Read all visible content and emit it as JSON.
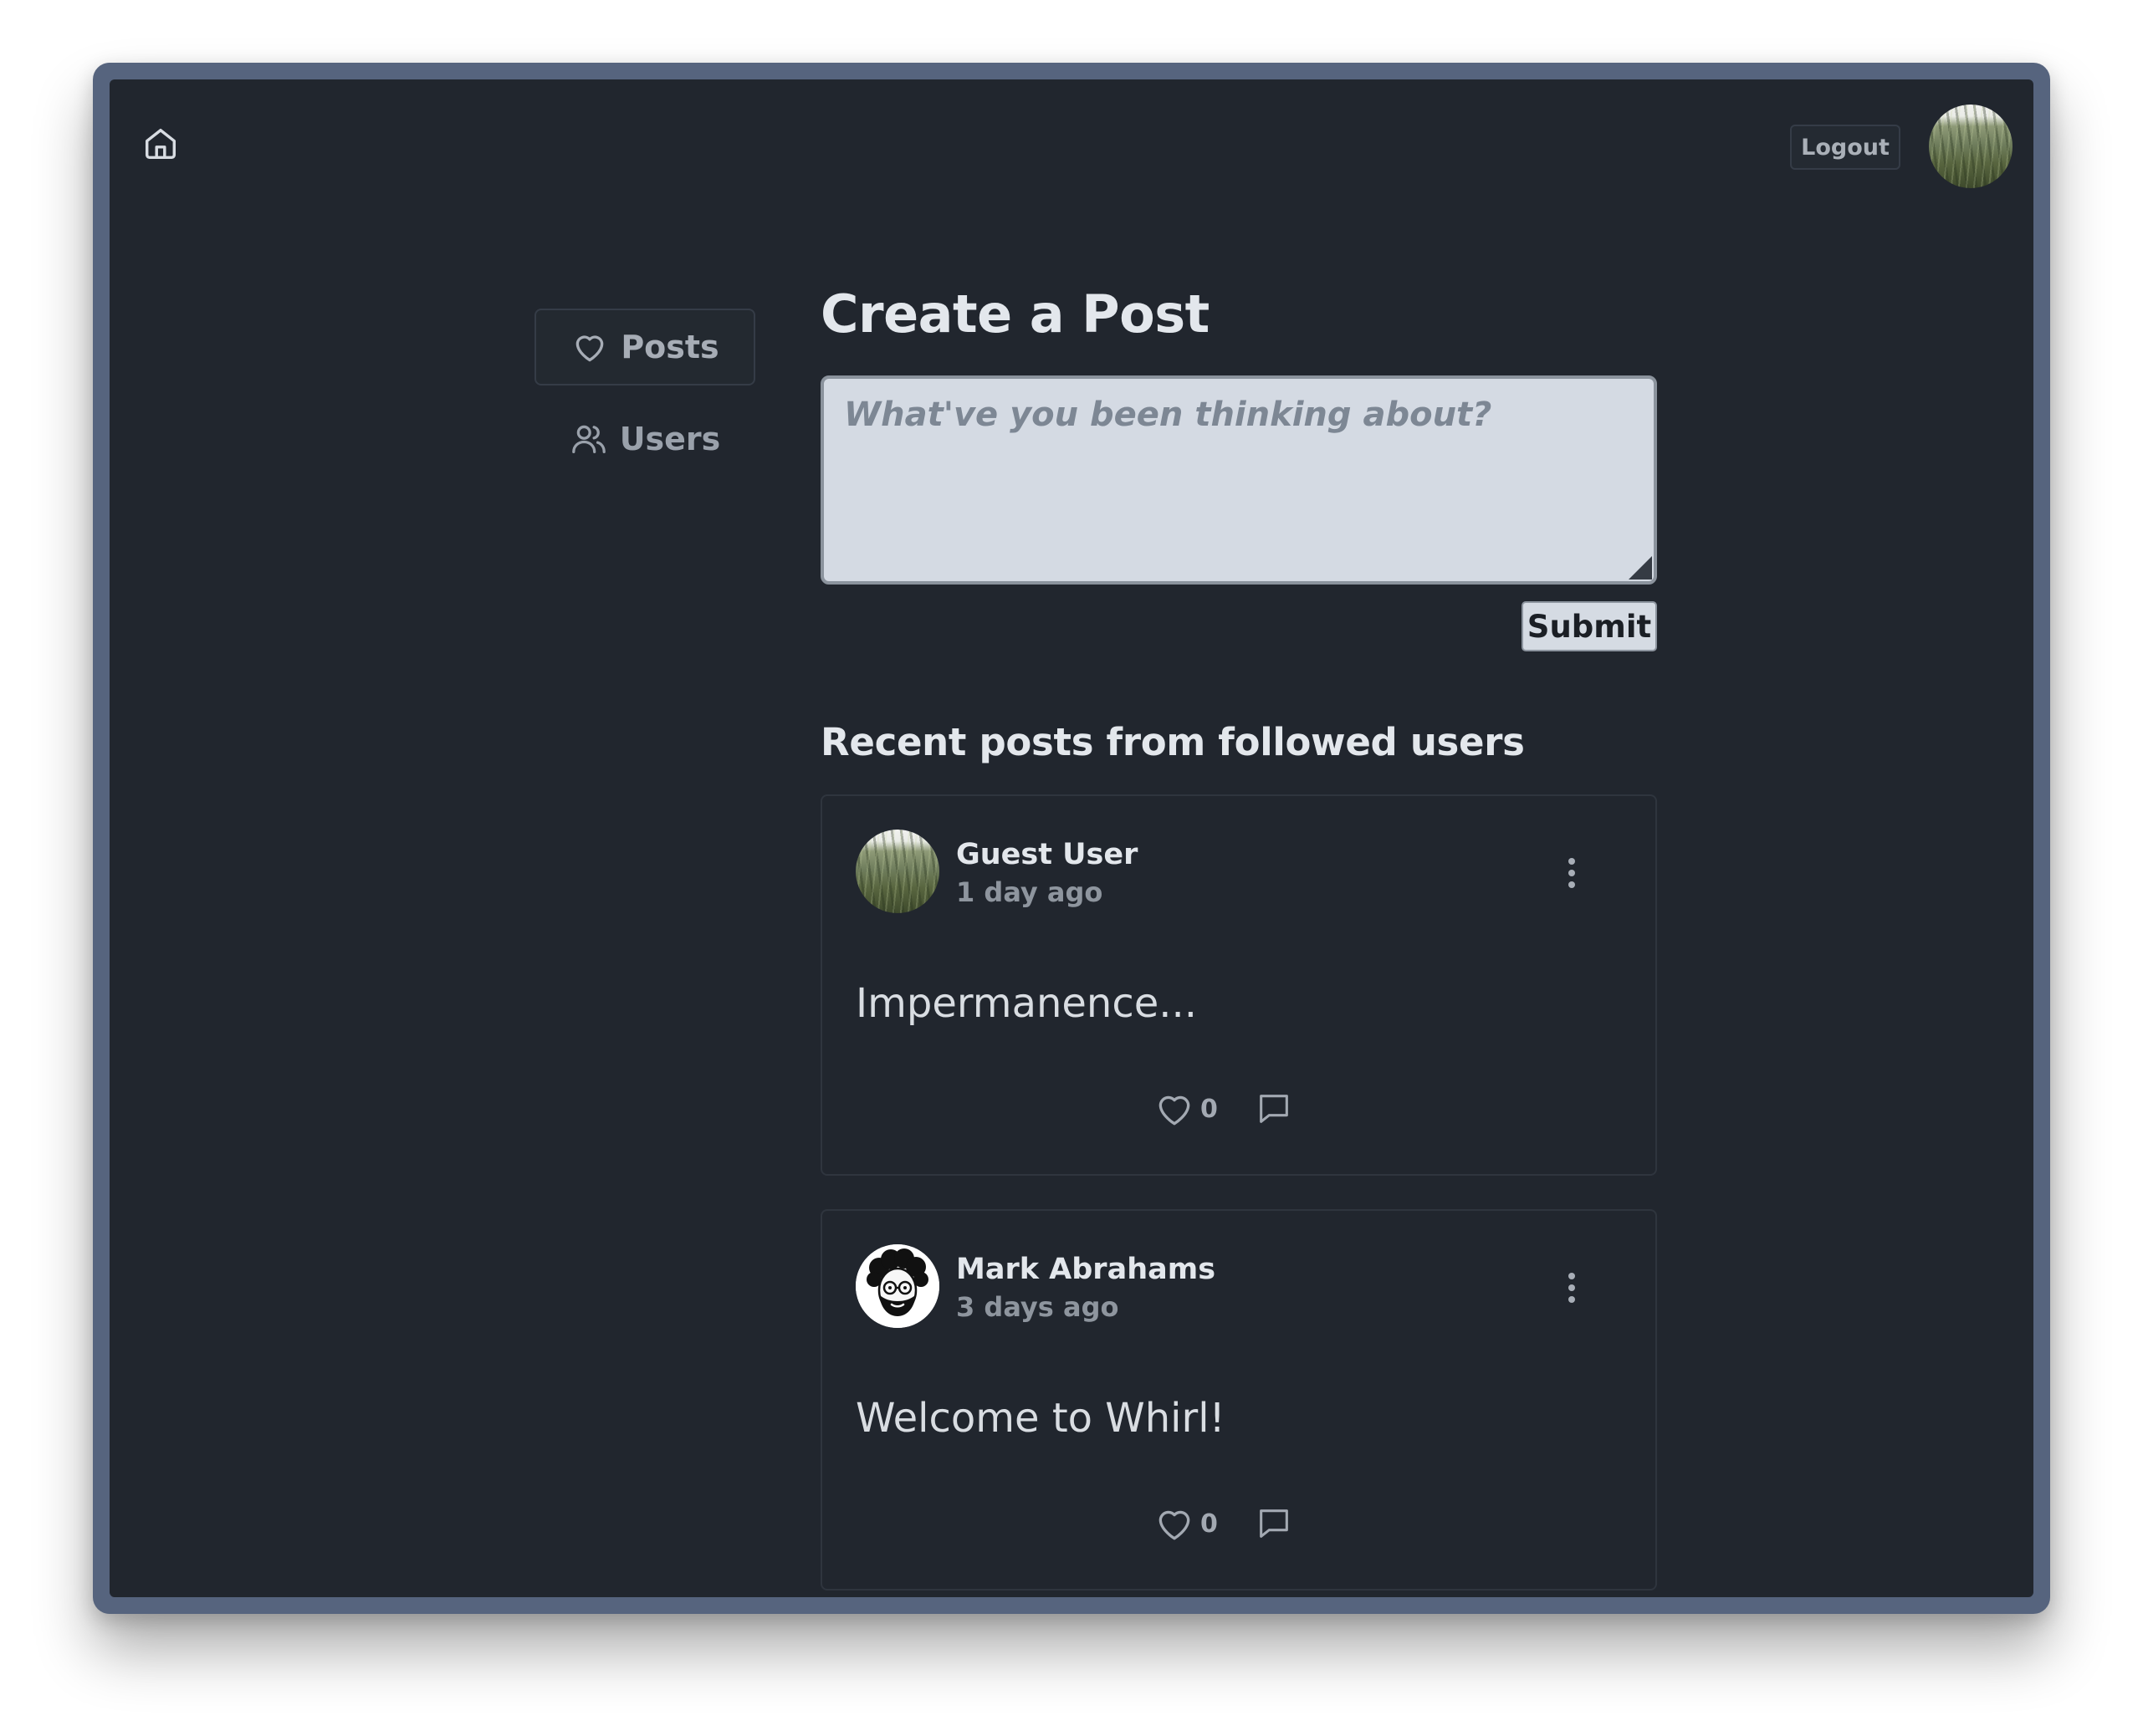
{
  "header": {
    "home_icon": "home-icon",
    "logout_label": "Logout",
    "avatar": "user-avatar-wheat-field"
  },
  "sidebar": {
    "items": [
      {
        "label": "Posts",
        "icon": "heart-icon",
        "active": true
      },
      {
        "label": "Users",
        "icon": "users-icon",
        "active": false
      }
    ]
  },
  "composer": {
    "title": "Create a Post",
    "placeholder": "What've you been thinking about?",
    "submit_label": "Submit"
  },
  "feed": {
    "title": "Recent posts from followed users",
    "posts": [
      {
        "author": "Guest User",
        "time": "1 day ago",
        "body": "Impermanence...",
        "likes": "0",
        "avatar": "wheat-field-photo"
      },
      {
        "author": "Mark Abrahams",
        "time": "3 days ago",
        "body": "Welcome to Whirl!",
        "likes": "0",
        "avatar": "cartoon-man-glasses-beard"
      }
    ]
  },
  "colors": {
    "page_background": "#21262e",
    "frame": "#56647e",
    "input_background": "#d4dae3",
    "text_primary": "#e3e7ec",
    "text_muted": "#8e959e"
  }
}
